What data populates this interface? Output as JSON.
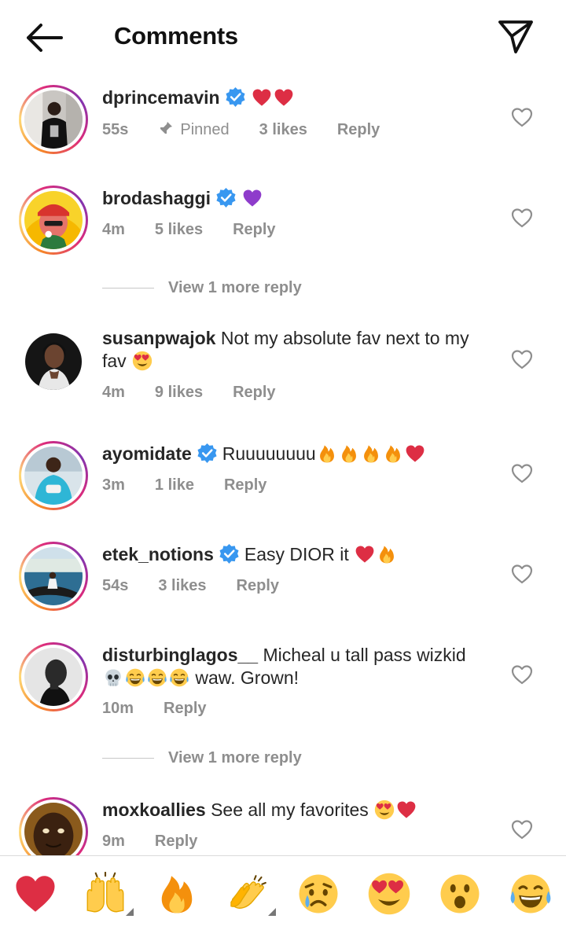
{
  "header": {
    "title": "Comments",
    "back_icon": "arrow-left-icon",
    "send_icon": "paper-plane-icon"
  },
  "comments": [
    {
      "username": "dprincemavin",
      "verified": true,
      "text": "",
      "emojis": [
        "red-heart",
        "red-heart"
      ],
      "time": "55s",
      "pinned": "Pinned",
      "likes": "3 likes",
      "reply": "Reply"
    },
    {
      "username": "brodashaggi",
      "verified": true,
      "text": "",
      "emojis": [
        "purple-heart"
      ],
      "time": "4m",
      "likes": "5 likes",
      "reply": "Reply",
      "more_replies": "View 1 more reply"
    },
    {
      "username": "susanpwajok",
      "verified": false,
      "text": "Not my absolute fav next to my fav",
      "emojis": [
        "heart-eyes"
      ],
      "time": "4m",
      "likes": "9 likes",
      "reply": "Reply"
    },
    {
      "username": "ayomidate",
      "verified": true,
      "text": "Ruuuuuuuu",
      "emojis": [
        "fire",
        "fire",
        "fire",
        "fire",
        "red-heart"
      ],
      "time": "3m",
      "likes": "1 like",
      "reply": "Reply"
    },
    {
      "username": "etek_notions",
      "verified": true,
      "text": "Easy DIOR it",
      "emojis": [
        "red-heart",
        "fire"
      ],
      "time": "54s",
      "likes": "3 likes",
      "reply": "Reply"
    },
    {
      "username": "disturbinglagos__",
      "verified": false,
      "text": "Micheal u tall pass wizkid",
      "text2": "waw. Grown!",
      "emojis": [
        "skull",
        "joy",
        "joy",
        "joy"
      ],
      "time": "10m",
      "likes": "",
      "reply": "Reply",
      "more_replies": "View 1 more reply"
    },
    {
      "username": "moxkoallies",
      "verified": false,
      "text": "See all my favorites",
      "emojis": [
        "heart-eyes",
        "red-heart"
      ],
      "time": "9m",
      "likes": "",
      "reply": "Reply"
    }
  ],
  "reactions": [
    "red-heart",
    "raising-hands",
    "fire",
    "clapping-hands",
    "sad-tear",
    "heart-eyes",
    "surprised",
    "joy"
  ],
  "colors": {
    "text": "#262626",
    "muted": "#8e8e8e",
    "verified": "#3897f0",
    "heart": "#e0245e"
  }
}
